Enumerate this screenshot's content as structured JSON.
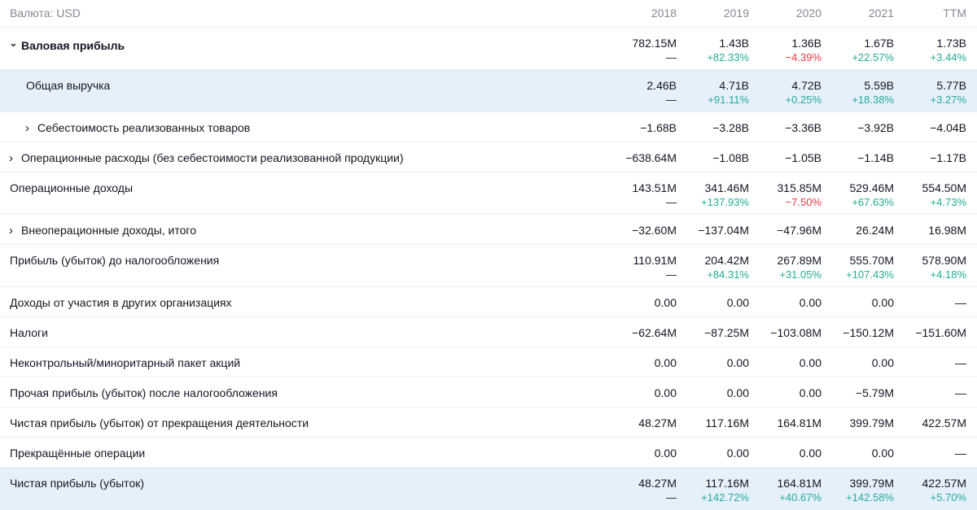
{
  "currency_label": "Валюта: USD",
  "columns": [
    "2018",
    "2019",
    "2020",
    "2021",
    "TTM"
  ],
  "rows": [
    {
      "label": "Валовая прибыль",
      "bold": true,
      "arrow": "expanded",
      "indent": false,
      "highlight": false,
      "values": [
        "782.15M",
        "1.43B",
        "1.36B",
        "1.67B",
        "1.73B"
      ],
      "changes": [
        {
          "t": "—",
          "s": "none"
        },
        {
          "t": "+82.33%",
          "s": "pos"
        },
        {
          "t": "−4.39%",
          "s": "neg"
        },
        {
          "t": "+22.57%",
          "s": "pos"
        },
        {
          "t": "+3.44%",
          "s": "pos"
        }
      ]
    },
    {
      "label": "Общая выручка",
      "bold": false,
      "arrow": null,
      "indent": true,
      "highlight": true,
      "values": [
        "2.46B",
        "4.71B",
        "4.72B",
        "5.59B",
        "5.77B"
      ],
      "changes": [
        {
          "t": "—",
          "s": "none"
        },
        {
          "t": "+91.11%",
          "s": "pos"
        },
        {
          "t": "+0.25%",
          "s": "pos"
        },
        {
          "t": "+18.38%",
          "s": "pos"
        },
        {
          "t": "+3.27%",
          "s": "pos"
        }
      ]
    },
    {
      "label": "Себестоимость реализованных товаров",
      "bold": false,
      "arrow": "collapsed",
      "indent": true,
      "highlight": false,
      "values": [
        "−1.68B",
        "−3.28B",
        "−3.36B",
        "−3.92B",
        "−4.04B"
      ],
      "changes": null
    },
    {
      "label": "Операционные расходы (без себестоимости реализованной продукции)",
      "bold": false,
      "arrow": "collapsed",
      "indent": false,
      "highlight": false,
      "values": [
        "−638.64M",
        "−1.08B",
        "−1.05B",
        "−1.14B",
        "−1.17B"
      ],
      "changes": null
    },
    {
      "label": "Операционные доходы",
      "bold": false,
      "arrow": null,
      "indent": false,
      "highlight": false,
      "values": [
        "143.51M",
        "341.46M",
        "315.85M",
        "529.46M",
        "554.50M"
      ],
      "changes": [
        {
          "t": "—",
          "s": "none"
        },
        {
          "t": "+137.93%",
          "s": "pos"
        },
        {
          "t": "−7.50%",
          "s": "neg"
        },
        {
          "t": "+67.63%",
          "s": "pos"
        },
        {
          "t": "+4.73%",
          "s": "pos"
        }
      ]
    },
    {
      "label": "Внеоперационные доходы, итого",
      "bold": false,
      "arrow": "collapsed",
      "indent": false,
      "highlight": false,
      "values": [
        "−32.60M",
        "−137.04M",
        "−47.96M",
        "26.24M",
        "16.98M"
      ],
      "changes": null
    },
    {
      "label": "Прибыль (убыток) до налогообложения",
      "bold": false,
      "arrow": null,
      "indent": false,
      "highlight": false,
      "values": [
        "110.91M",
        "204.42M",
        "267.89M",
        "555.70M",
        "578.90M"
      ],
      "changes": [
        {
          "t": "—",
          "s": "none"
        },
        {
          "t": "+84.31%",
          "s": "pos"
        },
        {
          "t": "+31.05%",
          "s": "pos"
        },
        {
          "t": "+107.43%",
          "s": "pos"
        },
        {
          "t": "+4.18%",
          "s": "pos"
        }
      ]
    },
    {
      "label": "Доходы от участия в других организациях",
      "bold": false,
      "arrow": null,
      "indent": false,
      "highlight": false,
      "values": [
        "0.00",
        "0.00",
        "0.00",
        "0.00",
        "—"
      ],
      "changes": null
    },
    {
      "label": "Налоги",
      "bold": false,
      "arrow": null,
      "indent": false,
      "highlight": false,
      "values": [
        "−62.64M",
        "−87.25M",
        "−103.08M",
        "−150.12M",
        "−151.60M"
      ],
      "changes": null
    },
    {
      "label": "Неконтрольный/миноритарный пакет акций",
      "bold": false,
      "arrow": null,
      "indent": false,
      "highlight": false,
      "values": [
        "0.00",
        "0.00",
        "0.00",
        "0.00",
        "—"
      ],
      "changes": null
    },
    {
      "label": "Прочая прибыль (убыток) после налогообложения",
      "bold": false,
      "arrow": null,
      "indent": false,
      "highlight": false,
      "values": [
        "0.00",
        "0.00",
        "0.00",
        "−5.79M",
        "—"
      ],
      "changes": null
    },
    {
      "label": "Чистая прибыль (убыток) от прекращения деятельности",
      "bold": false,
      "arrow": null,
      "indent": false,
      "highlight": false,
      "values": [
        "48.27M",
        "117.16M",
        "164.81M",
        "399.79M",
        "422.57M"
      ],
      "changes": null
    },
    {
      "label": "Прекращённые операции",
      "bold": false,
      "arrow": null,
      "indent": false,
      "highlight": false,
      "values": [
        "0.00",
        "0.00",
        "0.00",
        "0.00",
        "—"
      ],
      "changes": null
    },
    {
      "label": "Чистая прибыль (убыток)",
      "bold": false,
      "arrow": null,
      "indent": false,
      "highlight": true,
      "values": [
        "48.27M",
        "117.16M",
        "164.81M",
        "399.79M",
        "422.57M"
      ],
      "changes": [
        {
          "t": "—",
          "s": "none"
        },
        {
          "t": "+142.72%",
          "s": "pos"
        },
        {
          "t": "+40.67%",
          "s": "pos"
        },
        {
          "t": "+142.58%",
          "s": "pos"
        },
        {
          "t": "+5.70%",
          "s": "pos"
        }
      ]
    }
  ]
}
